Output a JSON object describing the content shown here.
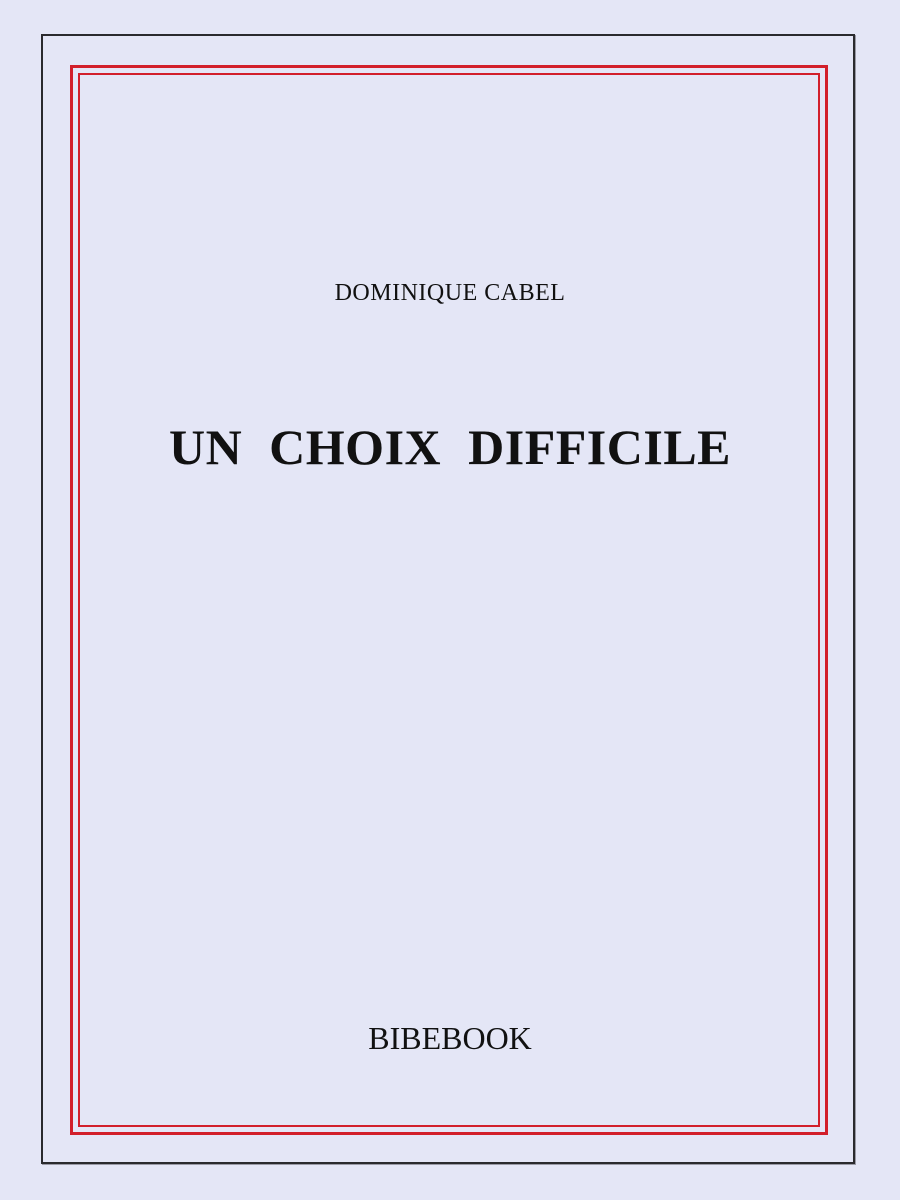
{
  "cover": {
    "author": "DOMINIQUE CABEL",
    "title": "UN CHOIX DIFFICILE",
    "publisher": "BIBEBOOK"
  },
  "colors": {
    "background": "#e4e6f6",
    "frame_border": "#2a2a2e",
    "accent_red": "#d21f2b",
    "text": "#111111"
  }
}
